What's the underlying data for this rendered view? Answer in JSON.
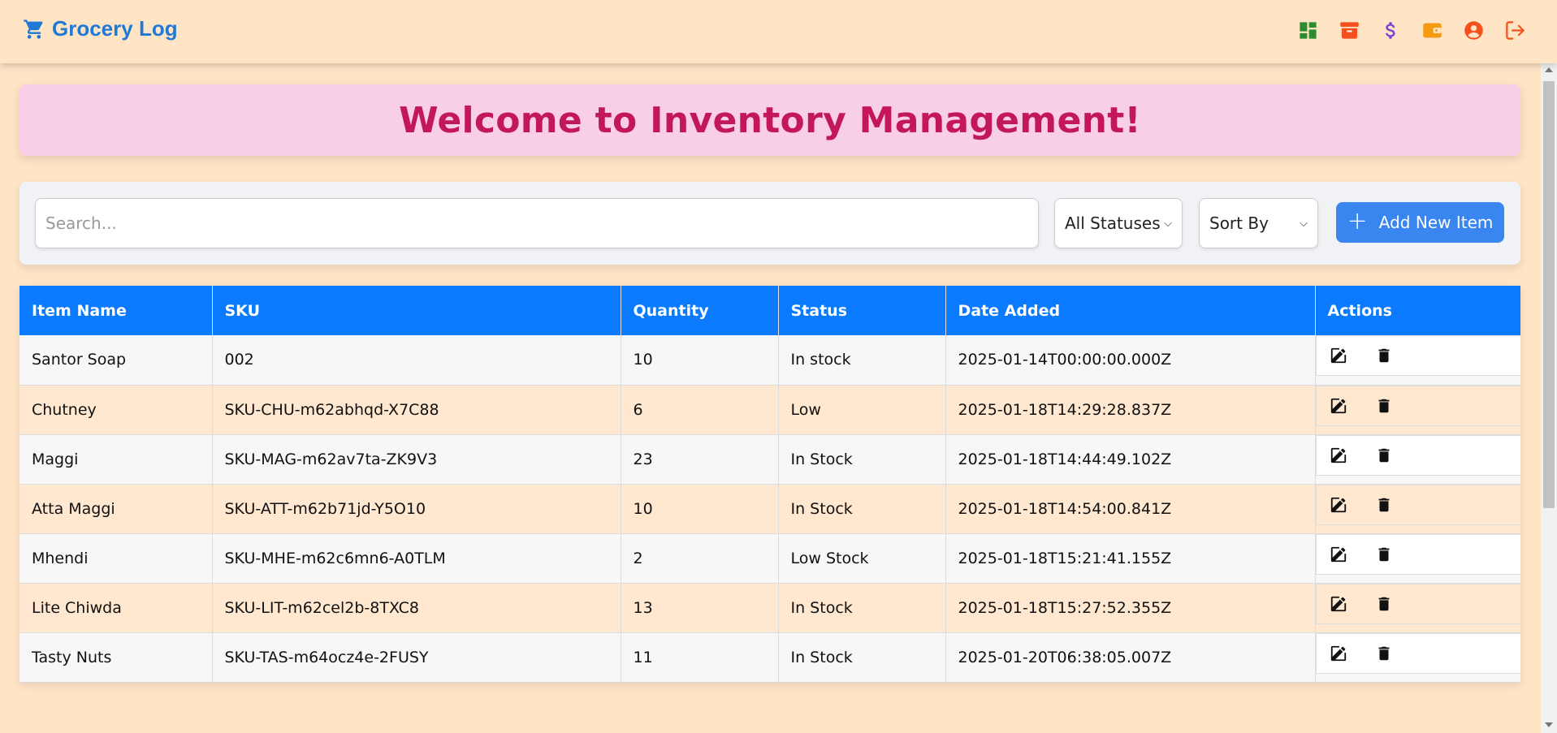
{
  "header": {
    "brand": "Grocery Log",
    "icons": [
      {
        "name": "dashboard-icon",
        "color": "#2e8b2e"
      },
      {
        "name": "archive-icon",
        "color": "#f4511e"
      },
      {
        "name": "dollar-icon",
        "color": "#7b3fd1"
      },
      {
        "name": "wallet-icon",
        "color": "#f59b12"
      },
      {
        "name": "user-circle-icon",
        "color": "#f4511e"
      },
      {
        "name": "logout-icon",
        "color": "#f4511e"
      }
    ]
  },
  "welcome": {
    "title": "Welcome to Inventory Management!"
  },
  "toolbar": {
    "search_placeholder": "Search...",
    "status_filter": "All Statuses",
    "sort_by": "Sort By",
    "add_label": "Add New Item"
  },
  "table": {
    "columns": [
      "Item Name",
      "SKU",
      "Quantity",
      "Status",
      "Date Added",
      "Actions"
    ],
    "rows": [
      {
        "name": "Santor Soap",
        "sku": "002",
        "quantity": "10",
        "status": "In stock",
        "date": "2025-01-14T00:00:00.000Z"
      },
      {
        "name": "Chutney",
        "sku": "SKU-CHU-m62abhqd-X7C88",
        "quantity": "6",
        "status": "Low",
        "date": "2025-01-18T14:29:28.837Z"
      },
      {
        "name": "Maggi",
        "sku": "SKU-MAG-m62av7ta-ZK9V3",
        "quantity": "23",
        "status": "In Stock",
        "date": "2025-01-18T14:44:49.102Z"
      },
      {
        "name": "Atta Maggi",
        "sku": "SKU-ATT-m62b71jd-Y5O10",
        "quantity": "10",
        "status": "In Stock",
        "date": "2025-01-18T14:54:00.841Z"
      },
      {
        "name": "Mhendi",
        "sku": "SKU-MHE-m62c6mn6-A0TLM",
        "quantity": "2",
        "status": "Low Stock",
        "date": "2025-01-18T15:21:41.155Z"
      },
      {
        "name": "Lite Chiwda",
        "sku": "SKU-LIT-m62cel2b-8TXC8",
        "quantity": "13",
        "status": "In Stock",
        "date": "2025-01-18T15:27:52.355Z"
      },
      {
        "name": "Tasty Nuts",
        "sku": "SKU-TAS-m64ocz4e-2FUSY",
        "quantity": "11",
        "status": "In Stock",
        "date": "2025-01-20T06:38:05.007Z"
      }
    ]
  },
  "colors": {
    "page_bg": "#ffe4c6",
    "brand": "#1f7ad6",
    "banner_bg": "#f9cfe8",
    "banner_text": "#c2185b",
    "table_header": "#0a7bff",
    "add_button": "#3a86f1"
  }
}
